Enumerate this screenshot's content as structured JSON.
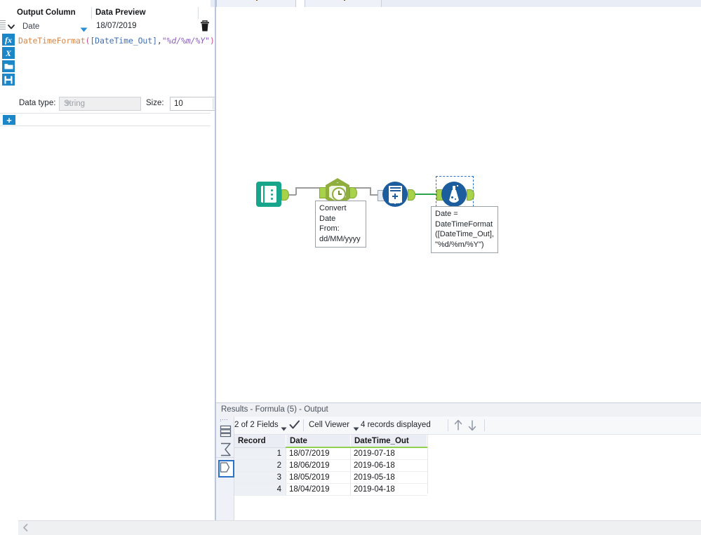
{
  "window": {
    "top_tabs": [
      "",
      "",
      ""
    ]
  },
  "config_panel": {
    "headers": {
      "output_column": "Output Column",
      "data_preview": "Data Preview"
    },
    "field_select": {
      "value": "Date",
      "icon": "chevron-down-icon"
    },
    "data_preview_value": "18/07/2019",
    "delete_icon": "trash-icon",
    "toolbar_icons": [
      {
        "name": "fx-icon",
        "glyph": "fx"
      },
      {
        "name": "variable-x-icon",
        "glyph": "X"
      },
      {
        "name": "folder-open-icon",
        "glyph": "folder"
      },
      {
        "name": "save-disk-icon",
        "glyph": "save"
      }
    ],
    "add_button_label": "+",
    "formula": {
      "full_text": "DateTimeFormat([DateTime_Out],\"%d/%m/%Y\")",
      "tokens": [
        {
          "text": "DateTimeFormat",
          "kind": "function"
        },
        {
          "text": "(",
          "kind": "bracket"
        },
        {
          "text": "[DateTime_Out]",
          "kind": "field"
        },
        {
          "text": ",",
          "kind": "plain"
        },
        {
          "text": "\"%d/%m/%Y\"",
          "kind": "string"
        },
        {
          "text": ")",
          "kind": "bracket"
        }
      ],
      "colors": {
        "function": "#d4874b",
        "bracket": "#d14b8f",
        "field": "#3f6fb5",
        "string": "#8b5fbf",
        "plain": "#444444"
      }
    },
    "data_type": {
      "label": "Data type:",
      "value": "String",
      "disabled": true
    },
    "size": {
      "label": "Size:",
      "value": "10"
    }
  },
  "canvas": {
    "nodes": [
      {
        "name": "input-data-tool",
        "icon": "book-icon",
        "color": "#17a68b"
      },
      {
        "name": "datetime-tool",
        "icon": "clock-hexagon-icon",
        "color": "#8fae3e"
      },
      {
        "name": "union-tool",
        "icon": "union-sheets-icon",
        "color": "#1c5d9e"
      },
      {
        "name": "formula-tool",
        "icon": "flask-icon",
        "color": "#1c5d9e",
        "selected": true
      }
    ],
    "annotations": [
      {
        "name": "convert-date-annotation",
        "lines": [
          "Convert Date",
          "From:",
          "dd/MM/yyyy"
        ]
      },
      {
        "name": "formula-annotation",
        "lines": [
          "Date =",
          "DateTimeFormat",
          "([DateTime_Out],",
          "\"%d/%m/%Y\")"
        ]
      }
    ],
    "selection_color": "#2a72c8",
    "active_wire_color": "#2aa34a"
  },
  "results": {
    "title": "Results - Formula (5) - Output",
    "toolbar": {
      "fields": "2 of 2 Fields",
      "fields_arrow_icon": "chevron-down-icon",
      "check_icon": "checkmark-icon",
      "cell_viewer": "Cell Viewer",
      "cell_viewer_arrow_icon": "chevron-down-icon",
      "records": "4 records displayed",
      "up_icon": "arrow-up-icon",
      "down_icon": "arrow-down-icon"
    },
    "rail_icons": [
      {
        "name": "table-view-icon",
        "selected": false
      },
      {
        "name": "summary-sigma-icon",
        "selected": false
      },
      {
        "name": "metadata-tag-icon",
        "selected": true
      }
    ],
    "table": {
      "columns": [
        "Record",
        "Date",
        "DateTime_Out"
      ],
      "rows": [
        [
          "1",
          "18/07/2019",
          "2019-07-18"
        ],
        [
          "2",
          "18/06/2019",
          "2019-06-18"
        ],
        [
          "3",
          "18/05/2019",
          "2019-05-18"
        ],
        [
          "4",
          "18/04/2019",
          "2019-04-18"
        ]
      ]
    },
    "scroll_left_icon": "chevron-left-icon"
  }
}
